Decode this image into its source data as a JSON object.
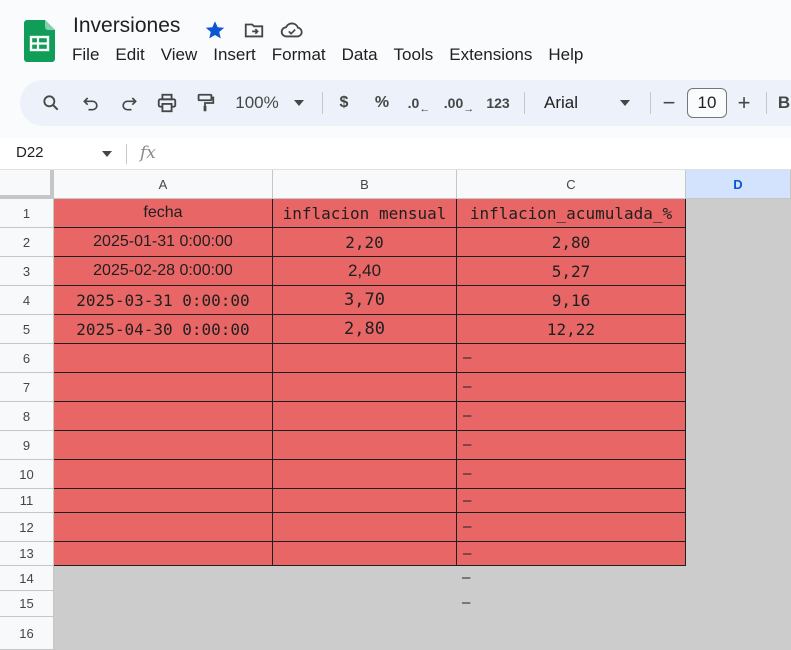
{
  "document": {
    "title": "Inversiones",
    "icons": [
      "star-icon",
      "move-to-folder-icon",
      "cloud-saved-icon"
    ],
    "brand_color": "#0f9d58",
    "star_color": "#0b57d0"
  },
  "menu": [
    "File",
    "Edit",
    "View",
    "Insert",
    "Format",
    "Data",
    "Tools",
    "Extensions",
    "Help"
  ],
  "toolbar": {
    "zoom": "100%",
    "currency": "$",
    "percent": "%",
    "decrease_decimal": ".0",
    "increase_decimal": ".00",
    "number_format": "123",
    "font": "Arial",
    "font_size": "10",
    "minus": "−",
    "plus": "+",
    "bold": "B"
  },
  "formula_bar": {
    "cell_ref": "D22",
    "fx": "fx",
    "formula": ""
  },
  "columns": [
    "A",
    "B",
    "C",
    "D"
  ],
  "active_column": "D",
  "rows": [
    "1",
    "2",
    "3",
    "4",
    "5",
    "6",
    "7",
    "8",
    "9",
    "10",
    "11",
    "12",
    "13",
    "14",
    "15",
    "16"
  ],
  "cells": {
    "header": [
      "fecha",
      "inflacion mensual",
      "inflacion_acumulada_%"
    ],
    "data": [
      [
        "2025-01-31 0:00:00",
        "2,20",
        "2,80"
      ],
      [
        "2025-02-28 0:00:00",
        "2,40",
        "5,27"
      ],
      [
        "2025-03-31 0:00:00",
        "3,70",
        "9,16"
      ],
      [
        "2025-04-30 0:00:00",
        "2,80",
        "12,22"
      ]
    ],
    "dash": "–"
  },
  "fill_color": "#e96666"
}
